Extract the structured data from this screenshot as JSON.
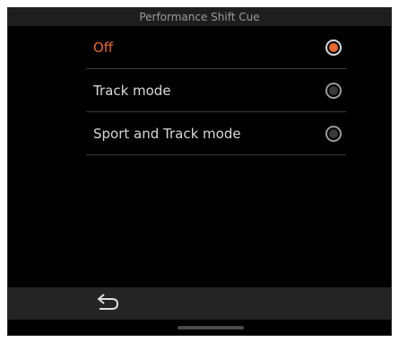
{
  "title": "Performance Shift Cue",
  "options": [
    {
      "label": "Off",
      "selected": true
    },
    {
      "label": "Track mode",
      "selected": false
    },
    {
      "label": "Sport and Track mode",
      "selected": false
    }
  ],
  "icons": {
    "back": "back-arrow-icon"
  },
  "colors": {
    "accent": "#e8682a",
    "text": "#d8d8d8",
    "background": "#000000"
  }
}
